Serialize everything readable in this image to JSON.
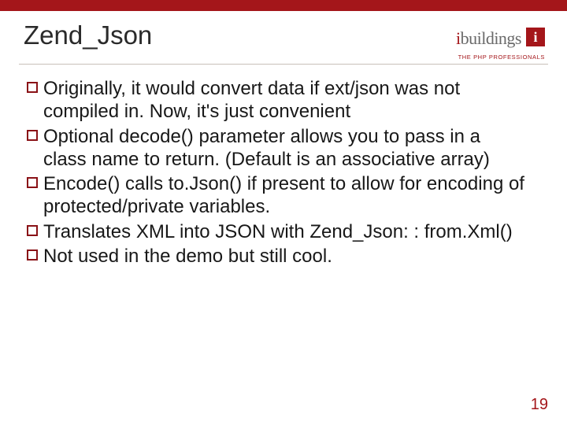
{
  "title": "Zend_Json",
  "logo": {
    "brand_prefix": "i",
    "brand_rest": "buildings",
    "box": "i",
    "tagline": "THE PHP PROFESSIONALS"
  },
  "bullets": [
    "Originally, it would convert data if ext/json was not compiled in. Now, it's just convenient",
    "Optional  decode() parameter allows you to pass in a class name to return. (Default is an associative array)",
    "Encode() calls to.Json() if present to allow for encoding of protected/private variables.",
    "Translates XML into JSON with Zend_Json: : from.Xml()",
    "Not used in the demo but still cool."
  ],
  "page_number": "19"
}
